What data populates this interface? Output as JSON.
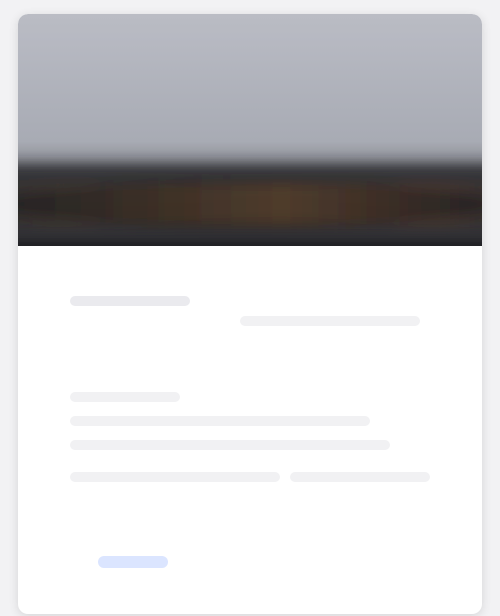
{
  "card": {
    "hero_image": {
      "alt": ""
    }
  },
  "content": {
    "lines": [
      "",
      "",
      "",
      "",
      "",
      "",
      ""
    ],
    "link": ""
  },
  "colors": {
    "background": "#f2f2f4",
    "card": "#ffffff",
    "placeholder": "#e8e8ec",
    "link_placeholder": "#dbe5ff"
  }
}
